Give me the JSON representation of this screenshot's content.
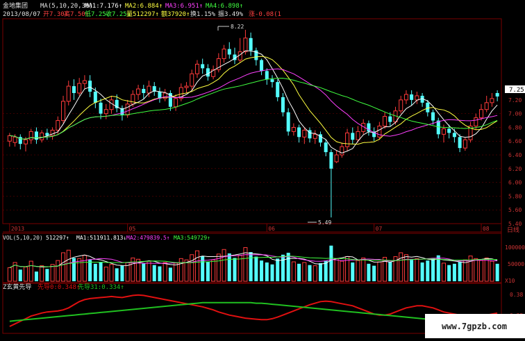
{
  "header": {
    "name": "金地集团",
    "ma_label": "MA(5,10,20,30)",
    "ma1": "MA1:7.176↑",
    "ma2": "MA2:6.884↑",
    "ma3": "MA3:6.951↑",
    "ma4": "MA4:6.898↑",
    "date": "2013/08/07",
    "open": "开7.30↑",
    "high": "高7.50↑",
    "low": "低7.25↓",
    "close": "收7.25↓",
    "volume": "量512297↑",
    "amount": "额37920↑",
    "turnover": "换1.15%",
    "amplitude": "振3.49%",
    "change": "涨-0.08(1"
  },
  "price_panel": {
    "y_ticks": [
      "7.25",
      "7.20",
      "7.00",
      "6.80",
      "6.60",
      "6.40",
      "6.20",
      "6.00",
      "5.80",
      "5.60",
      "5.40"
    ],
    "current_price_label": "7.25",
    "high_marker": "8.22",
    "low_marker": "5.49"
  },
  "time_axis": {
    "labels": [
      "2013",
      "05",
      "06",
      "07",
      "08"
    ],
    "period": "日线"
  },
  "volume_panel": {
    "label": "VOL(5,10,20)",
    "vol": "512297↑",
    "ma1": "MA1:511911.813↓",
    "ma2": "MA2:479839.5↑",
    "ma3": "MA3:549729↑",
    "y_ticks": [
      "100000",
      "50000"
    ],
    "unit": "X10"
  },
  "indicator_panel": {
    "name": "Z玄黄先导",
    "line1": "先导0:0.348↑",
    "line2": "先导31:0.334↑",
    "y_ticks": [
      "0.38",
      "0.35"
    ]
  },
  "watermark": "www.7gpzb.com",
  "colors": {
    "up": "#ff3b3b",
    "down": "#54ffff",
    "ma1": "#ffffff",
    "ma2": "#ffff40",
    "ma3": "#ff40ff",
    "ma4": "#40ff40",
    "grid": "#7a0000",
    "axis_text": "#cc3333",
    "ind_red": "#e01010",
    "ind_green": "#20c020"
  },
  "chart_data": {
    "type": "candlestick",
    "candles": [
      {
        "o": 6.6,
        "c": 6.68,
        "h": 6.72,
        "l": 6.52
      },
      {
        "o": 6.58,
        "c": 6.66,
        "h": 6.7,
        "l": 6.52
      },
      {
        "o": 6.66,
        "c": 6.56,
        "h": 6.7,
        "l": 6.48
      },
      {
        "o": 6.56,
        "c": 6.62,
        "h": 6.66,
        "l": 6.45
      },
      {
        "o": 6.62,
        "c": 6.74,
        "h": 6.78,
        "l": 6.56
      },
      {
        "o": 6.74,
        "c": 6.62,
        "h": 6.8,
        "l": 6.56
      },
      {
        "o": 6.62,
        "c": 6.72,
        "h": 6.76,
        "l": 6.58
      },
      {
        "o": 6.72,
        "c": 6.68,
        "h": 6.78,
        "l": 6.62
      },
      {
        "o": 6.68,
        "c": 6.76,
        "h": 6.8,
        "l": 6.62
      },
      {
        "o": 6.76,
        "c": 6.9,
        "h": 6.96,
        "l": 6.7
      },
      {
        "o": 6.9,
        "c": 7.18,
        "h": 7.26,
        "l": 6.86
      },
      {
        "o": 7.18,
        "c": 7.4,
        "h": 7.48,
        "l": 7.12
      },
      {
        "o": 7.4,
        "c": 7.3,
        "h": 7.5,
        "l": 7.2
      },
      {
        "o": 7.3,
        "c": 7.44,
        "h": 7.52,
        "l": 7.26
      },
      {
        "o": 7.44,
        "c": 7.48,
        "h": 7.56,
        "l": 7.36
      },
      {
        "o": 7.48,
        "c": 7.32,
        "h": 7.56,
        "l": 7.24
      },
      {
        "o": 7.32,
        "c": 7.16,
        "h": 7.38,
        "l": 7.08
      },
      {
        "o": 7.16,
        "c": 7.0,
        "h": 7.22,
        "l": 6.92
      },
      {
        "o": 7.0,
        "c": 7.06,
        "h": 7.14,
        "l": 6.92
      },
      {
        "o": 7.06,
        "c": 7.2,
        "h": 7.26,
        "l": 7.0
      },
      {
        "o": 7.2,
        "c": 7.08,
        "h": 7.28,
        "l": 7.02
      },
      {
        "o": 7.08,
        "c": 6.98,
        "h": 7.12,
        "l": 6.9
      },
      {
        "o": 6.98,
        "c": 7.14,
        "h": 7.2,
        "l": 6.94
      },
      {
        "o": 7.14,
        "c": 7.28,
        "h": 7.34,
        "l": 7.1
      },
      {
        "o": 7.28,
        "c": 7.36,
        "h": 7.42,
        "l": 7.2
      },
      {
        "o": 7.36,
        "c": 7.3,
        "h": 7.42,
        "l": 7.22
      },
      {
        "o": 7.3,
        "c": 7.4,
        "h": 7.48,
        "l": 7.24
      },
      {
        "o": 7.4,
        "c": 7.32,
        "h": 7.46,
        "l": 7.26
      },
      {
        "o": 7.32,
        "c": 7.22,
        "h": 7.38,
        "l": 7.16
      },
      {
        "o": 7.22,
        "c": 7.3,
        "h": 7.36,
        "l": 7.18
      },
      {
        "o": 7.3,
        "c": 7.1,
        "h": 7.34,
        "l": 7.04
      },
      {
        "o": 7.1,
        "c": 7.22,
        "h": 7.28,
        "l": 7.04
      },
      {
        "o": 7.22,
        "c": 7.38,
        "h": 7.44,
        "l": 7.18
      },
      {
        "o": 7.38,
        "c": 7.4,
        "h": 7.46,
        "l": 7.3
      },
      {
        "o": 7.4,
        "c": 7.58,
        "h": 7.64,
        "l": 7.34
      },
      {
        "o": 7.58,
        "c": 7.72,
        "h": 7.78,
        "l": 7.52
      },
      {
        "o": 7.72,
        "c": 7.66,
        "h": 7.8,
        "l": 7.58
      },
      {
        "o": 7.66,
        "c": 7.54,
        "h": 7.72,
        "l": 7.48
      },
      {
        "o": 7.54,
        "c": 7.64,
        "h": 7.7,
        "l": 7.5
      },
      {
        "o": 7.64,
        "c": 7.8,
        "h": 7.88,
        "l": 7.6
      },
      {
        "o": 7.8,
        "c": 7.94,
        "h": 8.0,
        "l": 7.74
      },
      {
        "o": 7.94,
        "c": 7.86,
        "h": 8.04,
        "l": 7.8
      },
      {
        "o": 7.86,
        "c": 7.78,
        "h": 7.96,
        "l": 7.72
      },
      {
        "o": 7.78,
        "c": 7.9,
        "h": 8.1,
        "l": 7.74
      },
      {
        "o": 7.9,
        "c": 8.1,
        "h": 8.22,
        "l": 7.86
      },
      {
        "o": 8.1,
        "c": 7.92,
        "h": 8.18,
        "l": 7.84
      },
      {
        "o": 7.92,
        "c": 7.78,
        "h": 7.96,
        "l": 7.7
      },
      {
        "o": 7.78,
        "c": 7.62,
        "h": 7.8,
        "l": 7.56
      },
      {
        "o": 7.62,
        "c": 7.5,
        "h": 7.66,
        "l": 7.42
      },
      {
        "o": 7.5,
        "c": 7.46,
        "h": 7.56,
        "l": 7.38
      },
      {
        "o": 7.46,
        "c": 7.24,
        "h": 7.5,
        "l": 7.18
      },
      {
        "o": 7.24,
        "c": 7.02,
        "h": 7.3,
        "l": 6.96
      },
      {
        "o": 7.02,
        "c": 6.74,
        "h": 7.08,
        "l": 6.68
      },
      {
        "o": 6.74,
        "c": 6.8,
        "h": 6.86,
        "l": 6.68
      },
      {
        "o": 6.8,
        "c": 6.66,
        "h": 6.84,
        "l": 6.58
      },
      {
        "o": 6.66,
        "c": 6.76,
        "h": 6.8,
        "l": 6.56
      },
      {
        "o": 6.76,
        "c": 6.64,
        "h": 6.8,
        "l": 6.58
      },
      {
        "o": 6.64,
        "c": 6.7,
        "h": 6.76,
        "l": 6.56
      },
      {
        "o": 6.7,
        "c": 6.58,
        "h": 6.74,
        "l": 6.52
      },
      {
        "o": 6.58,
        "c": 6.44,
        "h": 6.62,
        "l": 6.38
      },
      {
        "o": 6.44,
        "c": 6.2,
        "h": 6.48,
        "l": 5.49
      },
      {
        "o": 6.3,
        "c": 6.4,
        "h": 6.46,
        "l": 6.28
      },
      {
        "o": 6.4,
        "c": 6.52,
        "h": 6.58,
        "l": 6.36
      },
      {
        "o": 6.52,
        "c": 6.72,
        "h": 6.78,
        "l": 6.46
      },
      {
        "o": 6.72,
        "c": 6.62,
        "h": 6.8,
        "l": 6.56
      },
      {
        "o": 6.62,
        "c": 6.74,
        "h": 6.82,
        "l": 6.58
      },
      {
        "o": 6.74,
        "c": 6.86,
        "h": 6.92,
        "l": 6.7
      },
      {
        "o": 6.86,
        "c": 6.74,
        "h": 6.9,
        "l": 6.68
      },
      {
        "o": 6.74,
        "c": 6.66,
        "h": 6.8,
        "l": 6.6
      },
      {
        "o": 6.66,
        "c": 6.82,
        "h": 6.88,
        "l": 6.62
      },
      {
        "o": 6.82,
        "c": 6.96,
        "h": 7.02,
        "l": 6.78
      },
      {
        "o": 6.96,
        "c": 6.88,
        "h": 7.02,
        "l": 6.82
      },
      {
        "o": 6.88,
        "c": 7.04,
        "h": 7.1,
        "l": 6.84
      },
      {
        "o": 7.04,
        "c": 7.2,
        "h": 7.26,
        "l": 7.0
      },
      {
        "o": 7.2,
        "c": 7.28,
        "h": 7.34,
        "l": 7.14
      },
      {
        "o": 7.28,
        "c": 7.2,
        "h": 7.34,
        "l": 7.12
      },
      {
        "o": 7.2,
        "c": 7.26,
        "h": 7.32,
        "l": 7.14
      },
      {
        "o": 7.26,
        "c": 7.16,
        "h": 7.3,
        "l": 7.1
      },
      {
        "o": 7.16,
        "c": 7.02,
        "h": 7.2,
        "l": 6.96
      },
      {
        "o": 7.02,
        "c": 6.9,
        "h": 7.06,
        "l": 6.84
      },
      {
        "o": 6.9,
        "c": 6.7,
        "h": 6.94,
        "l": 6.64
      },
      {
        "o": 6.7,
        "c": 6.78,
        "h": 6.84,
        "l": 6.58
      },
      {
        "o": 6.78,
        "c": 6.72,
        "h": 6.84,
        "l": 6.64
      },
      {
        "o": 6.72,
        "c": 6.66,
        "h": 6.78,
        "l": 6.58
      },
      {
        "o": 6.66,
        "c": 6.5,
        "h": 6.7,
        "l": 6.44
      },
      {
        "o": 6.5,
        "c": 6.62,
        "h": 6.66,
        "l": 6.46
      },
      {
        "o": 6.62,
        "c": 6.82,
        "h": 6.88,
        "l": 6.58
      },
      {
        "o": 6.82,
        "c": 6.94,
        "h": 7.0,
        "l": 6.76
      },
      {
        "o": 6.94,
        "c": 7.06,
        "h": 7.14,
        "l": 6.9
      },
      {
        "o": 7.06,
        "c": 7.16,
        "h": 7.26,
        "l": 7.02
      },
      {
        "o": 7.16,
        "c": 7.22,
        "h": 7.3,
        "l": 7.1
      },
      {
        "o": 7.3,
        "c": 7.25,
        "h": 7.34,
        "l": 7.18
      }
    ],
    "volume": [
      42,
      58,
      36,
      44,
      62,
      30,
      48,
      38,
      52,
      64,
      88,
      96,
      72,
      70,
      80,
      66,
      54,
      60,
      44,
      52,
      40,
      48,
      58,
      72,
      68,
      56,
      62,
      50,
      46,
      58,
      42,
      56,
      70,
      66,
      82,
      94,
      78,
      60,
      66,
      84,
      98,
      86,
      72,
      80,
      104,
      90,
      76,
      64,
      58,
      52,
      70,
      82,
      88,
      60,
      54,
      58,
      50,
      48,
      56,
      64,
      110,
      70,
      62,
      76,
      58,
      64,
      72,
      54,
      48,
      60,
      74,
      60,
      76,
      88,
      82,
      66,
      70,
      58,
      64,
      72,
      80,
      56,
      50,
      54,
      60,
      66,
      78,
      70,
      64,
      72,
      62,
      54
    ],
    "ma_series": [
      {
        "name": "MA1",
        "period": 5
      },
      {
        "name": "MA2",
        "period": 10
      },
      {
        "name": "MA3",
        "period": 20
      },
      {
        "name": "MA4",
        "period": 30
      }
    ],
    "y_range": [
      5.4,
      8.3
    ],
    "volume_range": [
      0,
      120
    ],
    "indicator": {
      "red": [
        0.32,
        0.325,
        0.33,
        0.335,
        0.34,
        0.343,
        0.346,
        0.348,
        0.349,
        0.35,
        0.352,
        0.356,
        0.362,
        0.368,
        0.372,
        0.374,
        0.375,
        0.376,
        0.377,
        0.378,
        0.377,
        0.376,
        0.378,
        0.38,
        0.381,
        0.38,
        0.378,
        0.376,
        0.374,
        0.372,
        0.37,
        0.368,
        0.366,
        0.364,
        0.362,
        0.36,
        0.358,
        0.355,
        0.352,
        0.348,
        0.345,
        0.342,
        0.34,
        0.338,
        0.336,
        0.335,
        0.334,
        0.333,
        0.333,
        0.335,
        0.338,
        0.342,
        0.346,
        0.35,
        0.354,
        0.358,
        0.362,
        0.365,
        0.368,
        0.369,
        0.368,
        0.366,
        0.364,
        0.362,
        0.36,
        0.356,
        0.352,
        0.348,
        0.344,
        0.342,
        0.342,
        0.344,
        0.348,
        0.352,
        0.356,
        0.358,
        0.36,
        0.36,
        0.358,
        0.356,
        0.352,
        0.348,
        0.346,
        0.344,
        0.342,
        0.341,
        0.34,
        0.34,
        0.341,
        0.342,
        0.344,
        0.346
      ],
      "green": [
        0.33,
        0.331,
        0.332,
        0.333,
        0.334,
        0.335,
        0.336,
        0.337,
        0.338,
        0.339,
        0.34,
        0.341,
        0.342,
        0.343,
        0.344,
        0.345,
        0.346,
        0.347,
        0.348,
        0.349,
        0.35,
        0.351,
        0.352,
        0.353,
        0.354,
        0.355,
        0.356,
        0.357,
        0.358,
        0.359,
        0.36,
        0.361,
        0.362,
        0.363,
        0.364,
        0.365,
        0.366,
        0.366,
        0.366,
        0.366,
        0.366,
        0.366,
        0.366,
        0.366,
        0.366,
        0.366,
        0.365,
        0.365,
        0.364,
        0.363,
        0.362,
        0.361,
        0.36,
        0.359,
        0.358,
        0.357,
        0.356,
        0.355,
        0.354,
        0.353,
        0.352,
        0.351,
        0.35,
        0.349,
        0.348,
        0.347,
        0.346,
        0.345,
        0.344,
        0.343,
        0.342,
        0.341,
        0.34,
        0.339,
        0.338,
        0.337,
        0.336,
        0.335,
        0.334,
        0.333,
        0.332,
        0.331,
        0.33,
        0.329,
        0.328,
        0.328,
        0.328,
        0.329,
        0.33,
        0.331,
        0.332,
        0.333
      ],
      "range": [
        0.32,
        0.39
      ]
    }
  }
}
